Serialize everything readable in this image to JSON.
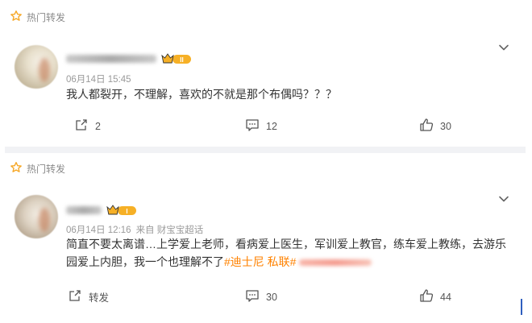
{
  "hot_label": "热门转发",
  "comments": [
    {
      "date": "06月14日 15:45",
      "level": "II",
      "source": "",
      "text": "我人都裂开，不理解，喜欢的不就是那个布偶吗？？？",
      "topics": [],
      "repost_label": "2",
      "comment_count": "12",
      "like_count": "30"
    },
    {
      "date": "06月14日 12:16",
      "level": "I",
      "source": "来自 财宝宝超话",
      "text": "简直不要太离谱…上学爱上老师，看病爱上医生，军训爱上教官，练车爱上教练，去游乐园爱上内胆，我一个也理解不了",
      "topics": [
        "#迪士尼 私联#"
      ],
      "repost_label": "转发",
      "comment_count": "30",
      "like_count": "44"
    }
  ],
  "colors": {
    "topic": "#ff8200",
    "accent_gold": "#f6b026",
    "separator": "#f1f2f5"
  },
  "icons": [
    "star-icon",
    "chevron-down-icon",
    "repost-icon",
    "comment-icon",
    "like-icon",
    "crown-badge-icon"
  ]
}
